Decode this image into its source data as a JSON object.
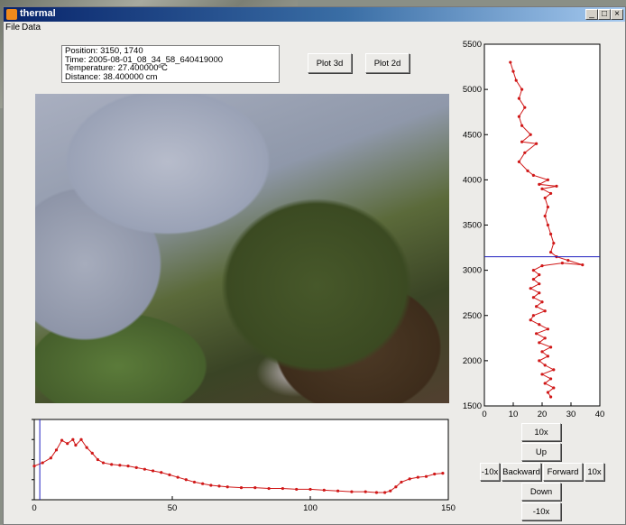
{
  "window": {
    "title": "thermal"
  },
  "menu": {
    "file": "File",
    "data": "Data"
  },
  "info": {
    "position": "Position: 3150, 1740",
    "time": "Time: 2005-08-01_08_34_58_640419000",
    "temperature": "Temperature: 27.400000ºC",
    "distance": "Distance: 38.400000 cm"
  },
  "buttons": {
    "plot3d": "Plot 3d",
    "plot2d": "Plot 2d",
    "up10": "10x",
    "up": "Up",
    "back10": "-10x",
    "backward": "Backward",
    "forward": "Forward",
    "fwd10": "10x",
    "down": "Down",
    "down10": "-10x"
  },
  "colors": {
    "series": "#d01818",
    "cursor": "#2020c0",
    "titlebar": "#08246b"
  },
  "chart_data": [
    {
      "type": "line",
      "orientation": "vertical-profile",
      "xlim": [
        0,
        40
      ],
      "ylim": [
        1500,
        5500
      ],
      "xticks": [
        0,
        10,
        20,
        30,
        40
      ],
      "yticks": [
        1500,
        2000,
        2500,
        3000,
        3500,
        4000,
        4500,
        5000,
        5500
      ],
      "cursor_y": 3150,
      "series": [
        {
          "points": [
            [
              23,
              1600
            ],
            [
              22,
              1650
            ],
            [
              24,
              1700
            ],
            [
              21,
              1750
            ],
            [
              23,
              1800
            ],
            [
              20,
              1850
            ],
            [
              24,
              1900
            ],
            [
              21,
              1950
            ],
            [
              19,
              2000
            ],
            [
              22,
              2050
            ],
            [
              20,
              2100
            ],
            [
              23,
              2150
            ],
            [
              19,
              2200
            ],
            [
              21,
              2250
            ],
            [
              18,
              2300
            ],
            [
              22,
              2350
            ],
            [
              19,
              2400
            ],
            [
              16,
              2450
            ],
            [
              17,
              2500
            ],
            [
              21,
              2550
            ],
            [
              18,
              2600
            ],
            [
              20,
              2650
            ],
            [
              17,
              2700
            ],
            [
              19,
              2750
            ],
            [
              16,
              2800
            ],
            [
              19,
              2850
            ],
            [
              17,
              2900
            ],
            [
              19,
              2950
            ],
            [
              17,
              3000
            ],
            [
              20,
              3050
            ],
            [
              27,
              3080
            ],
            [
              34,
              3060
            ],
            [
              29,
              3110
            ],
            [
              25,
              3150
            ],
            [
              23,
              3200
            ],
            [
              24,
              3300
            ],
            [
              23,
              3400
            ],
            [
              22,
              3500
            ],
            [
              21,
              3600
            ],
            [
              22,
              3700
            ],
            [
              21,
              3800
            ],
            [
              23,
              3850
            ],
            [
              20,
              3900
            ],
            [
              25,
              3930
            ],
            [
              19,
              3950
            ],
            [
              22,
              4000
            ],
            [
              17,
              4050
            ],
            [
              15,
              4100
            ],
            [
              12,
              4200
            ],
            [
              14,
              4300
            ],
            [
              18,
              4400
            ],
            [
              13,
              4420
            ],
            [
              16,
              4500
            ],
            [
              13,
              4600
            ],
            [
              12,
              4700
            ],
            [
              14,
              4800
            ],
            [
              12,
              4900
            ],
            [
              13,
              5000
            ],
            [
              11,
              5100
            ],
            [
              10,
              5200
            ],
            [
              9,
              5300
            ]
          ]
        }
      ]
    },
    {
      "type": "line",
      "xlim": [
        0,
        150
      ],
      "ylim": [
        0,
        100
      ],
      "xticks": [
        0,
        50,
        100,
        150
      ],
      "cursor_x": 2,
      "series": [
        {
          "points": [
            [
              0,
              42
            ],
            [
              3,
              46
            ],
            [
              6,
              52
            ],
            [
              8,
              62
            ],
            [
              10,
              74
            ],
            [
              12,
              70
            ],
            [
              14,
              75
            ],
            [
              15,
              68
            ],
            [
              17,
              75
            ],
            [
              19,
              65
            ],
            [
              21,
              58
            ],
            [
              23,
              50
            ],
            [
              25,
              46
            ],
            [
              28,
              44
            ],
            [
              31,
              43
            ],
            [
              34,
              42
            ],
            [
              37,
              40
            ],
            [
              40,
              38
            ],
            [
              43,
              36
            ],
            [
              46,
              34
            ],
            [
              49,
              31
            ],
            [
              52,
              28
            ],
            [
              55,
              25
            ],
            [
              58,
              22
            ],
            [
              61,
              20
            ],
            [
              64,
              18
            ],
            [
              67,
              17
            ],
            [
              70,
              16
            ],
            [
              75,
              15
            ],
            [
              80,
              15
            ],
            [
              85,
              14
            ],
            [
              90,
              14
            ],
            [
              95,
              13
            ],
            [
              100,
              13
            ],
            [
              105,
              12
            ],
            [
              110,
              11
            ],
            [
              115,
              10
            ],
            [
              120,
              10
            ],
            [
              124,
              9
            ],
            [
              127,
              9
            ],
            [
              129,
              11
            ],
            [
              131,
              16
            ],
            [
              133,
              22
            ],
            [
              136,
              26
            ],
            [
              139,
              28
            ],
            [
              142,
              29
            ],
            [
              145,
              32
            ],
            [
              148,
              33
            ]
          ]
        }
      ]
    }
  ]
}
